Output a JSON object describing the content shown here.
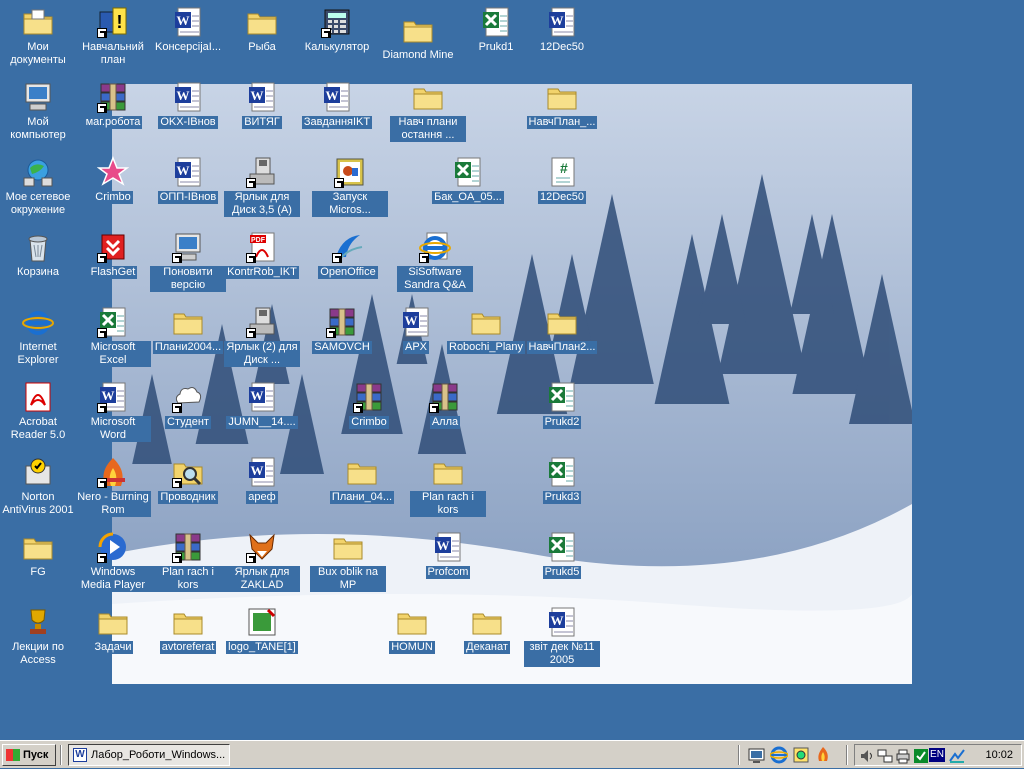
{
  "desktop_icons": [
    {
      "label": "Мои документы",
      "icon": "my-documents-icon"
    },
    {
      "label": "Мой компьютер",
      "icon": "my-computer-icon"
    },
    {
      "label": "Мое сетевое окружение",
      "icon": "network-icon"
    },
    {
      "label": "Корзина",
      "icon": "recycle-bin-icon"
    },
    {
      "label": "Internet Explorer",
      "icon": "internet-explorer-icon"
    },
    {
      "label": "Acrobat Reader 5.0",
      "icon": "acrobat-icon"
    },
    {
      "label": "Norton AntiVirus 2001",
      "icon": "norton-icon"
    },
    {
      "label": "FG",
      "icon": "folder-icon"
    },
    {
      "label": "Лекции по Access",
      "icon": "trophy-icon"
    },
    {
      "label": "Навчальний план",
      "icon": "help-shortcut-icon"
    },
    {
      "label": "маг.робота",
      "icon": "winrar-icon"
    },
    {
      "label": "Crimbo",
      "icon": "star-app-icon"
    },
    {
      "label": "FlashGet",
      "icon": "flashget-icon"
    },
    {
      "label": "Microsoft Excel",
      "icon": "excel-icon"
    },
    {
      "label": "Microsoft Word",
      "icon": "word-icon"
    },
    {
      "label": "Nero - Burning Rom",
      "icon": "nero-icon"
    },
    {
      "label": "Windows Media Player",
      "icon": "media-player-icon"
    },
    {
      "label": "Задачи",
      "icon": "folder-icon"
    },
    {
      "label": "KoнсерсijaI...",
      "icon": "word-doc-icon"
    },
    {
      "label": "OKX-IBнов",
      "icon": "word-doc-icon"
    },
    {
      "label": "ОПП-IBнов",
      "icon": "word-doc-icon"
    },
    {
      "label": "Поновити версію",
      "icon": "network-pc-icon"
    },
    {
      "label": "Плани2004...",
      "icon": "folder-icon"
    },
    {
      "label": "Студент",
      "icon": "cloud-icon"
    },
    {
      "label": "Проводник",
      "icon": "explorer-search-icon"
    },
    {
      "label": "Plan rach i kors",
      "icon": "winrar-icon"
    },
    {
      "label": "avtoreferat",
      "icon": "folder-icon"
    },
    {
      "label": "Рыба",
      "icon": "folder-icon"
    },
    {
      "label": "ВИТЯГ",
      "icon": "word-doc-icon"
    },
    {
      "label": "Ярлык для Диск 3,5 (A)",
      "icon": "floppy-icon"
    },
    {
      "label": "KontrRob_IKT",
      "icon": "pdf-icon"
    },
    {
      "label": "Ярлык (2) для Диск ...",
      "icon": "floppy-icon"
    },
    {
      "label": "JUMN__14....",
      "icon": "word-file-icon"
    },
    {
      "label": "ареф",
      "icon": "word-doc-icon"
    },
    {
      "label": "Ярлык для ZAKLAD",
      "icon": "fox-icon"
    },
    {
      "label": "logo_TANE[1]",
      "icon": "image-icon"
    },
    {
      "label": "Калькулятор",
      "icon": "calculator-icon"
    },
    {
      "label": "ЗавданняIKT",
      "icon": "word-doc-icon"
    },
    {
      "label": "Запуск Micros...",
      "icon": "powerpoint-icon"
    },
    {
      "label": "OpenOffice",
      "icon": "openoffice-icon"
    },
    {
      "label": "SAMOVCH",
      "icon": "winrar-icon"
    },
    {
      "label": "Crimbo",
      "icon": "winrar-icon"
    },
    {
      "label": "Плани_04...",
      "icon": "folder-icon"
    },
    {
      "label": "Bux oblik na MP",
      "icon": "folder-icon"
    },
    {
      "label": "Diamond Mine",
      "icon": "folder-icon"
    },
    {
      "label": "Навч плани остання ...",
      "icon": "folder-icon"
    },
    {
      "label": "SiSoftware Sandra Q&A",
      "icon": "ie-page-icon"
    },
    {
      "label": "APX",
      "icon": "word-doc-icon"
    },
    {
      "label": "HOMUN",
      "icon": "folder-icon"
    },
    {
      "label": "Prukd1",
      "icon": "excel-doc-icon"
    },
    {
      "label": "Бак_OA_05...",
      "icon": "excel-doc-icon"
    },
    {
      "label": "Robochi_Plany",
      "icon": "folder-icon"
    },
    {
      "label": "Алла",
      "icon": "winrar-icon"
    },
    {
      "label": "Plan rach i kors",
      "icon": "folder-icon"
    },
    {
      "label": "Profcom",
      "icon": "word-doc-icon"
    },
    {
      "label": "Деканат",
      "icon": "folder-icon"
    },
    {
      "label": "12Dec50",
      "icon": "word-doc-icon"
    },
    {
      "label": "НавчПлан_...",
      "icon": "folder-icon"
    },
    {
      "label": "12Dec50",
      "icon": "spreadsheet-icon"
    },
    {
      "label": "НавчПлан2...",
      "icon": "folder-icon"
    },
    {
      "label": "Prukd2",
      "icon": "excel-doc-icon"
    },
    {
      "label": "Prukd3",
      "icon": "excel-doc-icon"
    },
    {
      "label": "Prukd5",
      "icon": "excel-doc-icon"
    },
    {
      "label": "звіт дек №11 2005",
      "icon": "word-doc-icon"
    }
  ],
  "taskbar": {
    "start_label": "Пуск",
    "tasks": [
      {
        "label": "Лабор_Роботи_Windows...",
        "icon": "word-icon"
      }
    ],
    "quick_launch": [
      "show-desktop-icon",
      "internet-explorer-icon",
      "outlook-icon",
      "nero-icon"
    ],
    "tray_icons": [
      "volume-icon",
      "network-icon",
      "printer-icon",
      "antivirus-icon",
      "display-icon"
    ],
    "language": "EN",
    "clock": "10:02"
  },
  "colors": {
    "desktop_bg": "#3a6ea5",
    "taskbar_bg": "#d4d0c8"
  }
}
